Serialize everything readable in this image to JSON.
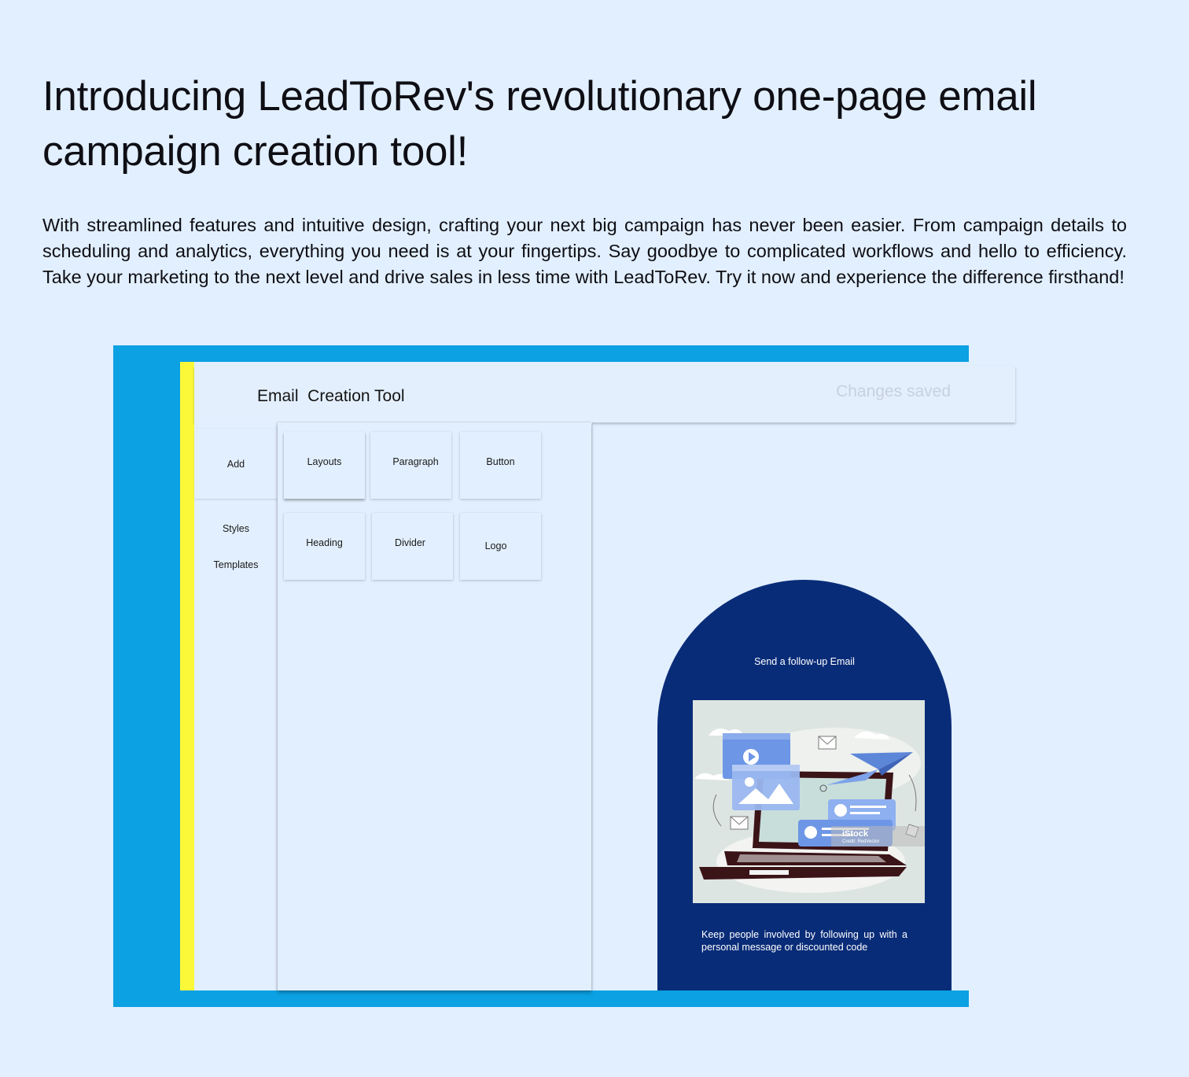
{
  "hero": {
    "headline": "Introducing LeadToRev's revolutionary one-page email campaign creation tool!",
    "intro": "With streamlined features and intuitive design, crafting your next big campaign has never been easier. From campaign details to scheduling and analytics, everything you need is at your fingertips.  Say goodbye to complicated workflows and hello to efficiency. Take your marketing to the next level and drive sales in less time with LeadToRev. Try it now and experience the difference firsthand!"
  },
  "tool": {
    "title": "Email  Creation Tool",
    "status": "Changes saved"
  },
  "sidebar": {
    "items": [
      {
        "label": "Add"
      },
      {
        "label": "Styles"
      },
      {
        "label": "Templates"
      }
    ]
  },
  "blocks": [
    {
      "label": "Layouts"
    },
    {
      "label": "Paragraph"
    },
    {
      "label": "Button"
    },
    {
      "label": "Heading"
    },
    {
      "label": "Divider"
    },
    {
      "label": "Logo"
    }
  ],
  "preview": {
    "title": "Send a follow-up Email",
    "image_watermark": "iStock",
    "image_credit": "Credit: RedVector",
    "body": "Keep people involved by following up with a personal message or discounted code"
  },
  "colors": {
    "page_background": "#e2effe",
    "frame_blue": "#0ba1e2",
    "accent_yellow": "#fbf839",
    "preview_navy": "#092c78",
    "status_grey": "#c8d1dd"
  }
}
